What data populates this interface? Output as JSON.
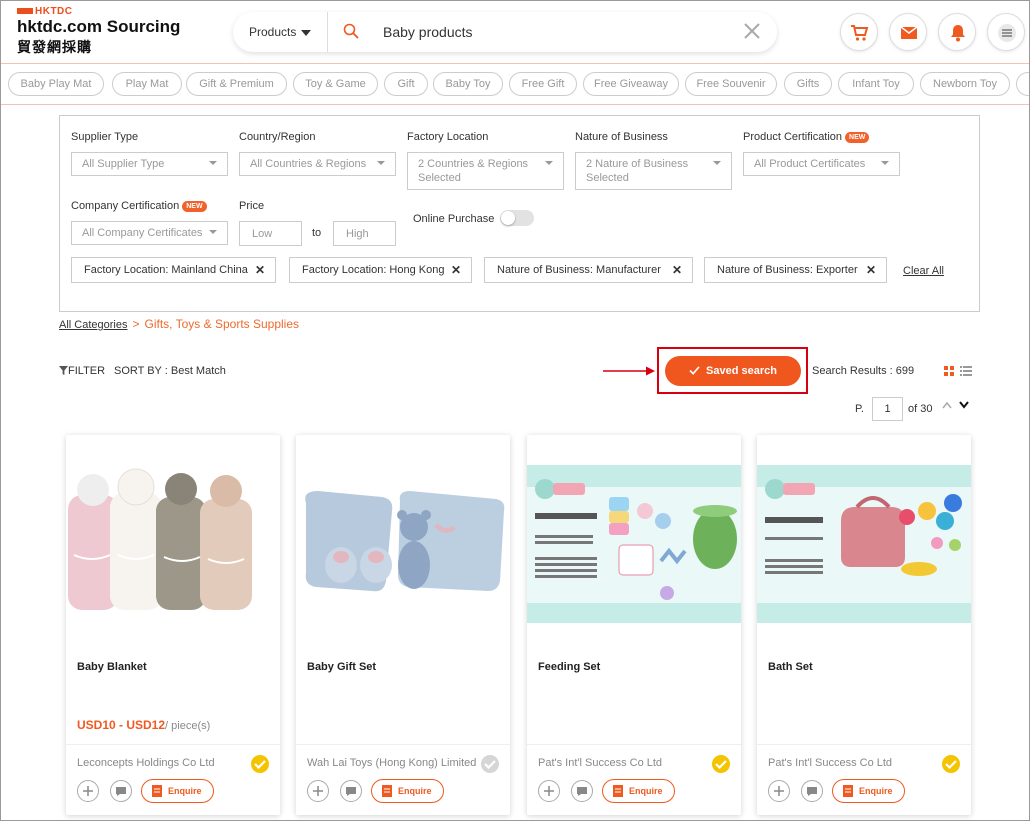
{
  "header": {
    "logo_top": "HKTDC",
    "logo_main": "hktdc.com Sourcing",
    "logo_cn": "貿發網採購",
    "search_category": "Products",
    "search_value": "Baby products"
  },
  "tags": [
    "Baby Play Mat",
    "Play Mat",
    "Gift & Premium",
    "Toy & Game",
    "Gift",
    "Baby Toy",
    "Free Gift",
    "Free Giveaway",
    "Free Souvenir",
    "Gifts",
    "Infant Toy",
    "Newborn Toy"
  ],
  "filters": {
    "supplier_type": {
      "label": "Supplier Type",
      "value": "All Supplier Type"
    },
    "country": {
      "label": "Country/Region",
      "value": "All Countries & Regions"
    },
    "factory_location": {
      "label": "Factory Location",
      "value": "2 Countries & Regions Selected"
    },
    "nature": {
      "label": "Nature of Business",
      "value": "2 Nature of Business Selected"
    },
    "product_cert": {
      "label": "Product Certification",
      "value": "All Product Certificates"
    },
    "company_cert": {
      "label": "Company Certification",
      "value": "All Company Certificates"
    },
    "price": {
      "label": "Price",
      "low": "Low",
      "to": "to",
      "high": "High"
    },
    "online_purchase": "Online Purchase",
    "new_badge": "NEW"
  },
  "chips": [
    "Factory Location: Mainland China",
    "Factory Location: Hong Kong",
    "Nature of Business: Manufacturer",
    "Nature of Business: Exporter"
  ],
  "chip_close": "✕",
  "clear_all": "Clear All",
  "breadcrumb": {
    "root": "All Categories",
    "sep": ">",
    "current": "Gifts, Toys & Sports Supplies"
  },
  "toolbar": {
    "filter": "FILTER",
    "sort": "SORT BY : Best Match",
    "saved_search": "Saved search",
    "results": "Search Results : 699",
    "page_prefix": "P.",
    "page_value": "1",
    "page_of": "of 30"
  },
  "products": [
    {
      "name": "Baby Blanket",
      "price": "USD10 - USD12",
      "unit": "/ piece(s)",
      "supplier": "Leconcepts Holdings Co Ltd"
    },
    {
      "name": "Baby Gift Set",
      "price": "",
      "unit": "",
      "supplier": "Wah Lai Toys (Hong Kong) Limited"
    },
    {
      "name": "Feeding Set",
      "price": "",
      "unit": "",
      "supplier": "Pat's Int'l Success Co Ltd"
    },
    {
      "name": "Bath Set",
      "price": "",
      "unit": "",
      "supplier": "Pat's Int'l Success Co Ltd"
    }
  ],
  "enquire_label": "Enquire",
  "colors": {
    "brand": "#ee5a1f",
    "highlight": "#d7000f"
  }
}
